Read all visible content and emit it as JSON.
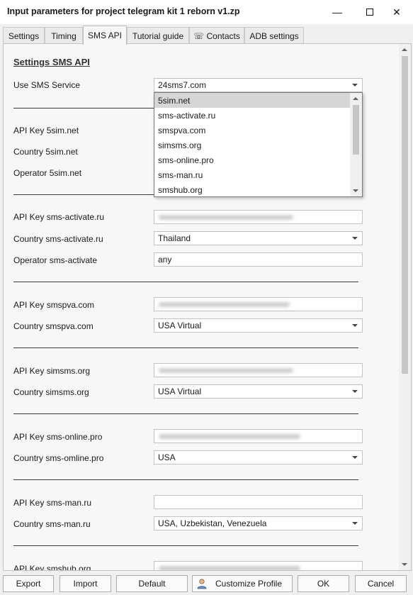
{
  "window": {
    "title": "Input parameters for project telegram kit 1 reborn v1.zp"
  },
  "tabs": [
    {
      "label": "Settings"
    },
    {
      "label": "Timing"
    },
    {
      "label": "SMS API"
    },
    {
      "label": "Tutorial guide"
    },
    {
      "label": "☏ Contacts"
    },
    {
      "label": "ADB settings"
    }
  ],
  "panel": {
    "title": "Settings SMS API",
    "labels": {
      "use_sms_service": "Use SMS Service",
      "api_key_5sim": "API Key 5sim.net",
      "country_5sim": "Country 5sim.net",
      "operator_5sim": "Operator 5sim.net",
      "api_key_sms_activate": "API Key sms-activate.ru",
      "country_sms_activate": "Country sms-activate.ru",
      "operator_sms_activate": "Operator sms-activate",
      "api_key_smspva": "API Key smspva.com",
      "country_smspva": "Country smspva.com",
      "api_key_simsms": "API Key simsms.org",
      "country_simsms": "Country simsms.org",
      "api_key_sms_online": "API Key sms-online.pro",
      "country_sms_online": "Country sms-omline.pro",
      "api_key_sms_man": "API Key sms-man.ru",
      "country_sms_man": "Country sms-man.ru",
      "api_key_smshub": "API Key smshub.org"
    },
    "values": {
      "use_sms_service": "24sms7.com",
      "country_sms_activate": "Thailand",
      "operator_sms_activate": "any",
      "country_smspva": "USA Virtual",
      "country_simsms": "USA Virtual",
      "country_sms_online": "USA",
      "api_key_sms_man": "",
      "country_sms_man": "USA, Uzbekistan, Venezuela"
    }
  },
  "dropdown": {
    "options": [
      {
        "label": "5sim.net",
        "selected": true
      },
      {
        "label": "sms-activate.ru",
        "selected": false
      },
      {
        "label": "smspva.com",
        "selected": false
      },
      {
        "label": "simsms.org",
        "selected": false
      },
      {
        "label": "sms-online.pro",
        "selected": false
      },
      {
        "label": "sms-man.ru",
        "selected": false
      },
      {
        "label": "smshub.org",
        "selected": false
      }
    ]
  },
  "footer": {
    "export": "Export",
    "import": "Import",
    "default": "Default",
    "customize_profile": "Customize Profile",
    "ok": "OK",
    "cancel": "Cancel"
  }
}
